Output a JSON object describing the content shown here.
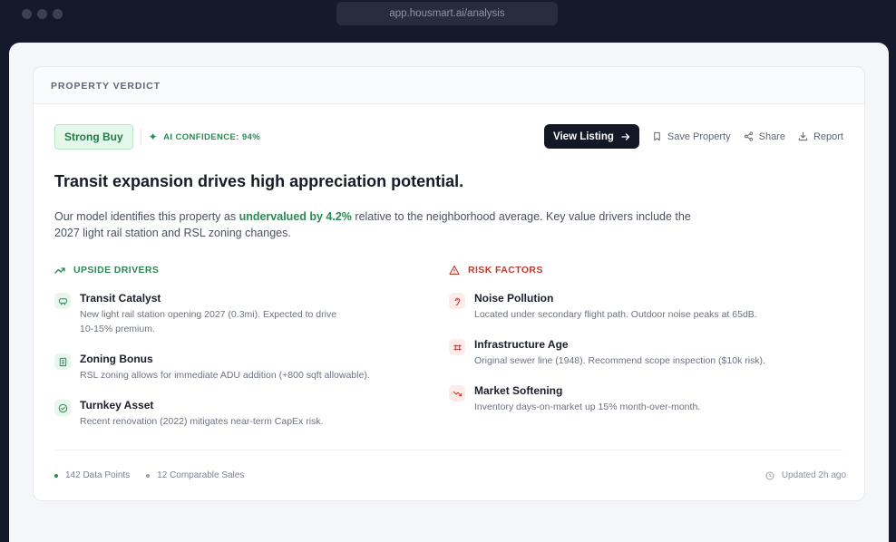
{
  "browser": {
    "url": "app.housmart.ai/analysis"
  },
  "card": {
    "header": "PROPERTY VERDICT",
    "verdict": "Strong Buy",
    "confidence": "AI CONFIDENCE: 94%",
    "actions": {
      "view_listing": "View Listing",
      "save": "Save Property",
      "share": "Share",
      "report": "Report"
    },
    "headline": "Transit expansion drives high appreciation potential.",
    "summary": {
      "before": "Our model identifies this property as ",
      "highlight": "undervalued by 4.2%",
      "after": " relative to the neighborhood average. Key value drivers include the 2027 light rail station and RSL zoning changes."
    },
    "upside": {
      "title": "UPSIDE DRIVERS",
      "items": [
        {
          "title": "Transit Catalyst",
          "desc": "New light rail station opening 2027 (0.3mi). Expected to drive",
          "desc2": "10-15% premium.",
          "icon": "train-icon"
        },
        {
          "title": "Zoning Bonus",
          "desc": "RSL zoning allows for immediate ADU addition (+800 sqft allowable).",
          "icon": "building-icon"
        },
        {
          "title": "Turnkey Asset",
          "desc": "Recent renovation (2022) mitigates near-term CapEx risk.",
          "icon": "check-circle-icon"
        }
      ]
    },
    "risk": {
      "title": "RISK FACTORS",
      "items": [
        {
          "title": "Noise Pollution",
          "desc": "Located under secondary flight path. Outdoor noise peaks at 65dB.",
          "icon": "ear-icon"
        },
        {
          "title": "Infrastructure Age",
          "desc": "Original sewer line (1948). Recommend scope inspection ($10k risk).",
          "icon": "pipe-icon"
        },
        {
          "title": "Market Softening",
          "desc": "Inventory days-on-market up 15% month-over-month.",
          "icon": "trend-down-icon"
        }
      ]
    },
    "footer": {
      "data_points": "142 Data Points",
      "comparables": "12 Comparable Sales",
      "updated": "Updated 2h ago"
    }
  },
  "colors": {
    "green": "#2a8a52",
    "red": "#c0392b",
    "dark": "#121826"
  }
}
